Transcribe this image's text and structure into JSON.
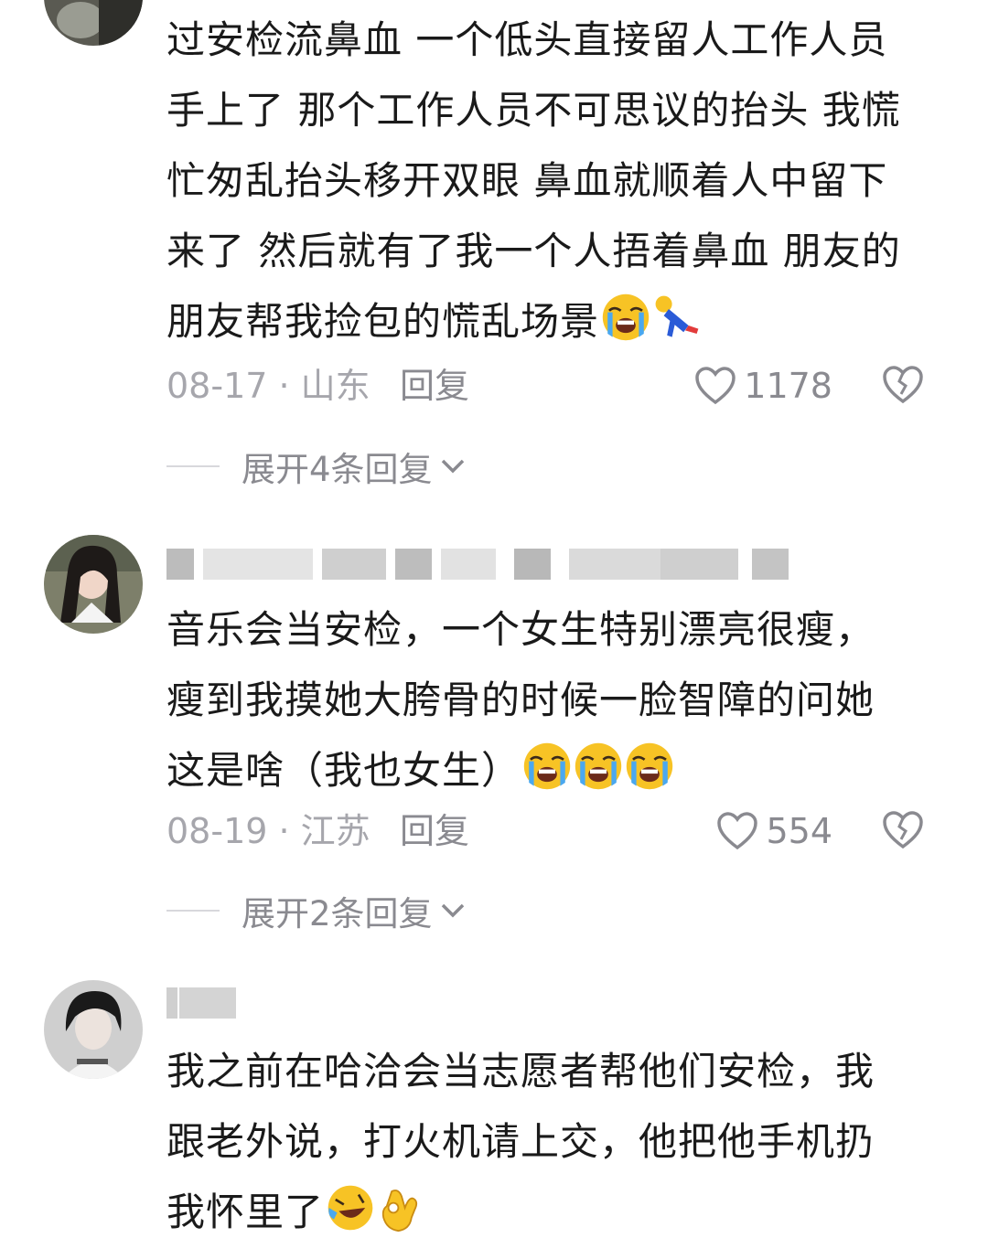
{
  "comments": [
    {
      "text_lines": [
        "过安检流鼻血 一个低头直接留人工作人员",
        "手上了 那个工作人员不可思议的抬头 我慌",
        "忙匆乱抬头移开双眼 鼻血就顺着人中留下",
        "来了 然后就有了我一个人捂着鼻血 朋友的",
        "朋友帮我捡包的慌乱场景"
      ],
      "date_location": "08-17 · 山东",
      "reply_label": "回复",
      "likes": "1178",
      "expand_label": "展开4条回复"
    },
    {
      "text_lines": [
        "音乐会当安检，一个女生特别漂亮很瘦，",
        "瘦到我摸她大胯骨的时候一脸智障的问她",
        "这是啥（我也女生）"
      ],
      "date_location": "08-19 · 江苏",
      "reply_label": "回复",
      "likes": "554",
      "expand_label": "展开2条回复"
    },
    {
      "text_lines": [
        "我之前在哈洽会当志愿者帮他们安检，我",
        "跟老外说，打火机请上交，他把他手机扔",
        "我怀里了"
      ]
    }
  ],
  "icons": {
    "like": "heart-outline-icon",
    "dislike": "broken-heart-icon",
    "expand": "chevron-down-icon",
    "emoji_cry": "loudly-crying-emoji",
    "emoji_fall": "falling-person-emoji",
    "emoji_laugh": "rolling-laughing-emoji",
    "emoji_ok": "ok-hand-emoji"
  },
  "colors": {
    "meta": "#a6a6ac",
    "text": "#1a1a1a",
    "emoji_yellow": "#f7c325"
  }
}
